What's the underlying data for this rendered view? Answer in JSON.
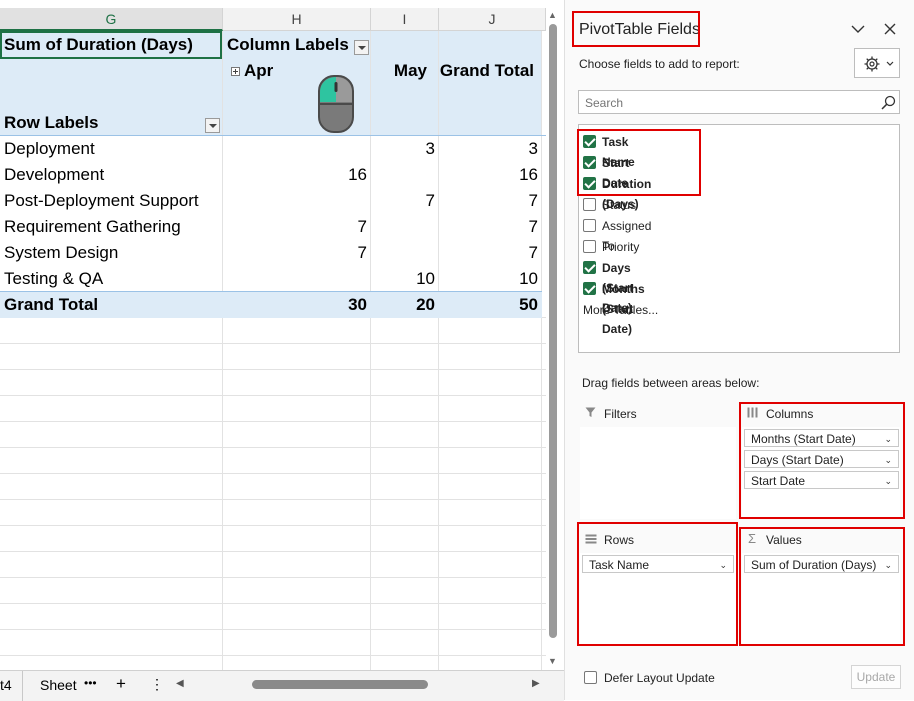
{
  "sheet": {
    "columns": [
      "G",
      "H",
      "I",
      "J"
    ],
    "pivot": {
      "value_header": "Sum of Duration (Days)",
      "column_labels": "Column Labels",
      "row_labels": "Row Labels",
      "col_apr": "Apr",
      "col_may": "May",
      "col_grand": "Grand Total",
      "rows": [
        {
          "label": "Deployment",
          "apr": "",
          "may": "3",
          "total": "3"
        },
        {
          "label": "Development",
          "apr": "16",
          "may": "",
          "total": "16"
        },
        {
          "label": "Post-Deployment Support",
          "apr": "",
          "may": "7",
          "total": "7"
        },
        {
          "label": "Requirement Gathering",
          "apr": "7",
          "may": "",
          "total": "7"
        },
        {
          "label": "System Design",
          "apr": "7",
          "may": "",
          "total": "7"
        },
        {
          "label": "Testing & QA",
          "apr": "",
          "may": "10",
          "total": "10"
        }
      ],
      "grand": {
        "label": "Grand Total",
        "apr": "30",
        "may": "20",
        "total": "50"
      }
    }
  },
  "tabs": {
    "partial_tab": "t4",
    "active_tab": "Sheet",
    "more": "•••",
    "add": "+",
    "menu": "⋮"
  },
  "panel": {
    "title": "PivotTable Fields",
    "subtitle": "Choose fields to add to report:",
    "search_placeholder": "Search",
    "fields": [
      {
        "label": "Task Name",
        "checked": true
      },
      {
        "label": "Start Date",
        "checked": true
      },
      {
        "label": "Duration (Days)",
        "checked": true
      },
      {
        "label": "Status",
        "checked": false
      },
      {
        "label": "Assigned To",
        "checked": false
      },
      {
        "label": "Priority",
        "checked": false
      },
      {
        "label": "Days (Start Date)",
        "checked": true
      },
      {
        "label": "Months (Start Date)",
        "checked": true
      }
    ],
    "more_tables": "More Tables...",
    "drag_hint": "Drag fields between areas below:",
    "filters_title": "Filters",
    "columns_title": "Columns",
    "rows_title": "Rows",
    "values_title": "Values",
    "columns_items": [
      "Months (Start Date)",
      "Days (Start Date)",
      "Start Date"
    ],
    "rows_items": [
      "Task Name"
    ],
    "values_items": [
      "Sum of Duration (Days)"
    ],
    "defer_label": "Defer Layout Update",
    "update_label": "Update"
  },
  "colors": {
    "accent_green": "#217346",
    "highlight_red": "#e00000",
    "pivot_header_fill": "#ddebf7"
  }
}
